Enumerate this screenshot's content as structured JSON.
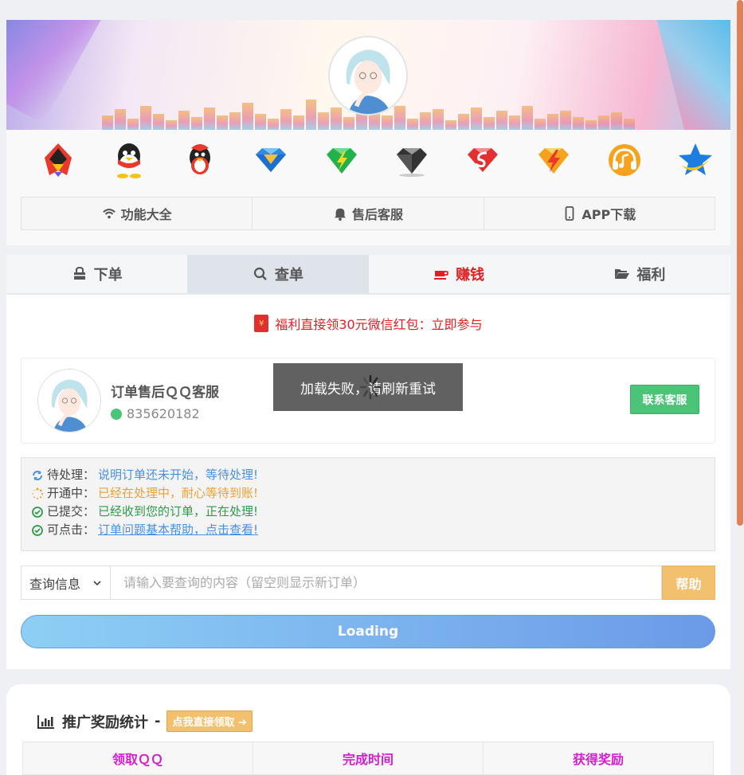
{
  "header": {
    "icons": [
      "qq-vip-penguin-icon",
      "qq-penguin-icon",
      "red-penguin-icon",
      "blue-diamond-icon",
      "green-diamond-icon",
      "black-diamond-icon",
      "red-diamond-icon",
      "yellow-lightning-diamond-icon",
      "music-icon",
      "star-icon"
    ],
    "nav": [
      {
        "label": "功能大全",
        "icon": "wifi-icon"
      },
      {
        "label": "售后客服",
        "icon": "bell-icon"
      },
      {
        "label": "APP下载",
        "icon": "mobile-icon"
      }
    ]
  },
  "tabs": [
    {
      "label": "下单",
      "icon": "shopping-bag-icon"
    },
    {
      "label": "查单",
      "icon": "search-icon"
    },
    {
      "label": "赚钱",
      "icon": "coffee-icon"
    },
    {
      "label": "福利",
      "icon": "folder-open-icon"
    }
  ],
  "promo": {
    "text": "福利直接领30元微信红包：立即参与",
    "icon_text": "¥"
  },
  "service": {
    "name": "订单售后ＱＱ客服",
    "qq": "835620182",
    "contact_label": "联系客服",
    "toast": "加载失败，请刷新重试"
  },
  "legend": [
    {
      "label": "待处理：",
      "desc": "说明订单还未开始，等待处理!"
    },
    {
      "label": "开通中：",
      "desc": "已经在处理中，耐心等待到账!"
    },
    {
      "label": "已提交：",
      "desc": "已经收到您的订单，正在处理!"
    },
    {
      "label": "可点击：",
      "desc": "订单问题基本帮助，点击查看!"
    }
  ],
  "query": {
    "select_value": "查询信息",
    "placeholder": "请输入要查询的内容（留空则显示新订单）",
    "help_label": "帮助",
    "loading_label": "Loading"
  },
  "stats": {
    "title": "推广奖励统计",
    "separator": "-",
    "claim_label": "点我直接领取",
    "columns": [
      "领取ＱＱ",
      "完成时间",
      "获得奖励"
    ]
  },
  "colors": {
    "accent_green": "#4cc477",
    "accent_red": "#e02020",
    "help_yellow": "#f3c06e",
    "column_magenta": "#d21ed0"
  }
}
